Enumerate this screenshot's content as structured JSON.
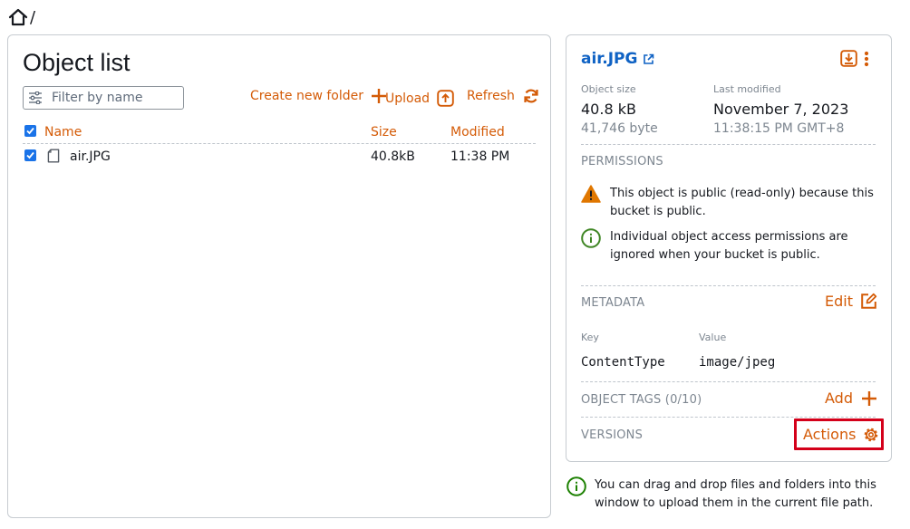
{
  "breadcrumb": {
    "separator": "/"
  },
  "object_list": {
    "title": "Object list",
    "filter_placeholder": "Filter by name",
    "create_folder_label": "Create new folder",
    "upload_label": "Upload",
    "refresh_label": "Refresh",
    "columns": {
      "name": "Name",
      "size": "Size",
      "modified": "Modified"
    },
    "rows": [
      {
        "name": "air.JPG",
        "size": "40.8kB",
        "modified": "11:38 PM"
      }
    ]
  },
  "details": {
    "filename": "air.JPG",
    "object_size_label": "Object size",
    "object_size": "40.8 kB",
    "object_size_bytes": "41,746 byte",
    "last_modified_label": "Last modified",
    "last_modified_date": "November 7, 2023",
    "last_modified_time": "11:38:15 PM GMT+8",
    "permissions_header": "PERMISSIONS",
    "warning_line1": "This object is public (read-only) because this",
    "warning_line2": "bucket is public.",
    "info_line1": "Individual object access permissions are",
    "info_line2": "ignored when your bucket is public.",
    "metadata_header": "METADATA",
    "edit_label": "Edit",
    "key_label": "Key",
    "value_label": "Value",
    "meta_key": "ContentType",
    "meta_value": "image/jpeg",
    "tags_header": "OBJECT TAGS (0/10)",
    "add_label": "Add",
    "versions_header": "VERSIONS",
    "actions_label": "Actions"
  },
  "tip": {
    "line1": "You can drag and drop files and folders into this",
    "line2": "window to upload them in the current file path."
  },
  "colors": {
    "accent": "#d45b07",
    "link": "#0f62c4",
    "highlight": "#d4001a",
    "success": "#1d8102"
  }
}
